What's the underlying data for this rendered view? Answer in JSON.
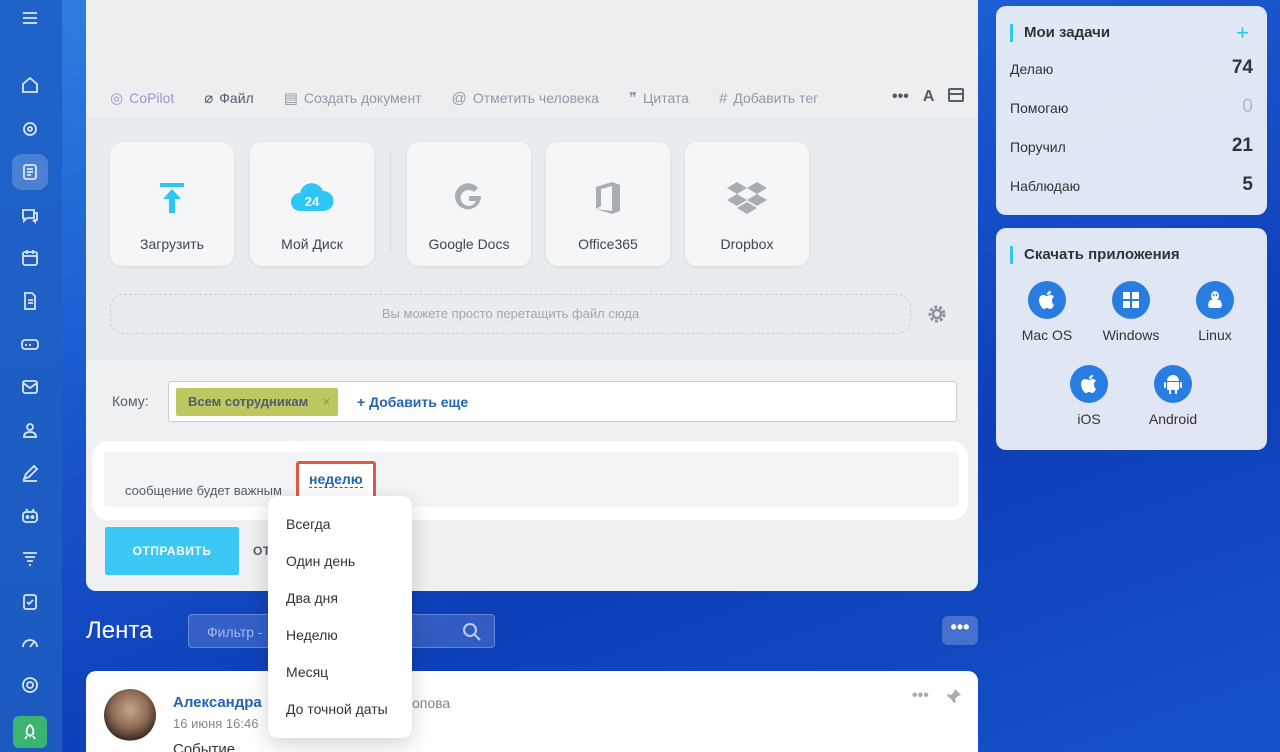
{
  "composer": {
    "toolbar": {
      "copilot": "CoPilot",
      "file": "Файл",
      "create_doc": "Создать документ",
      "mention": "Отметить человека",
      "quote": "Цитата",
      "tag": "Добавить тег"
    },
    "tiles": [
      {
        "label": "Загрузить",
        "icon": "upload-icon"
      },
      {
        "label": "Мой Диск",
        "icon": "cloud-24-icon"
      },
      {
        "label": "Google Docs",
        "icon": "google-icon"
      },
      {
        "label": "Office365",
        "icon": "office-icon"
      },
      {
        "label": "Dropbox",
        "icon": "dropbox-icon"
      }
    ],
    "dropzone_text": "Вы можете просто перетащить файл сюда",
    "to_label": "Кому:",
    "recipient_chip": "Всем сотрудникам",
    "add_more": "+ Добавить еще",
    "important_text": "сообщение будет важным",
    "important_period": "неделю",
    "send": "ОТПРАВИТЬ",
    "cancel": "ОТ"
  },
  "dropdown": {
    "items": [
      "Всегда",
      "Один день",
      "Два дня",
      "Неделю",
      "Месяц",
      "До точной даты"
    ]
  },
  "feed": {
    "title": "Лента",
    "filter_placeholder": "Фильтр -",
    "post": {
      "author": "Александра",
      "author_rest": "опова",
      "date": "16 июня 16:46",
      "body": "Событие"
    }
  },
  "tasks": {
    "title": "Мои задачи",
    "rows": [
      {
        "label": "Делаю",
        "count": "74"
      },
      {
        "label": "Помогаю",
        "count": "0"
      },
      {
        "label": "Поручил",
        "count": "21"
      },
      {
        "label": "Наблюдаю",
        "count": "5"
      }
    ]
  },
  "apps": {
    "title": "Скачать приложения",
    "items": [
      {
        "label": "Mac OS",
        "icon": "apple-icon"
      },
      {
        "label": "Windows",
        "icon": "windows-icon"
      },
      {
        "label": "Linux",
        "icon": "linux-icon"
      },
      {
        "label": "iOS",
        "icon": "apple-icon"
      },
      {
        "label": "Android",
        "icon": "android-icon"
      }
    ]
  },
  "colors": {
    "accent": "#2fc6f6",
    "send_button": "#3bc8f5",
    "highlight": "#e2574c",
    "link": "#2066b0",
    "chip": "#bdc960"
  }
}
